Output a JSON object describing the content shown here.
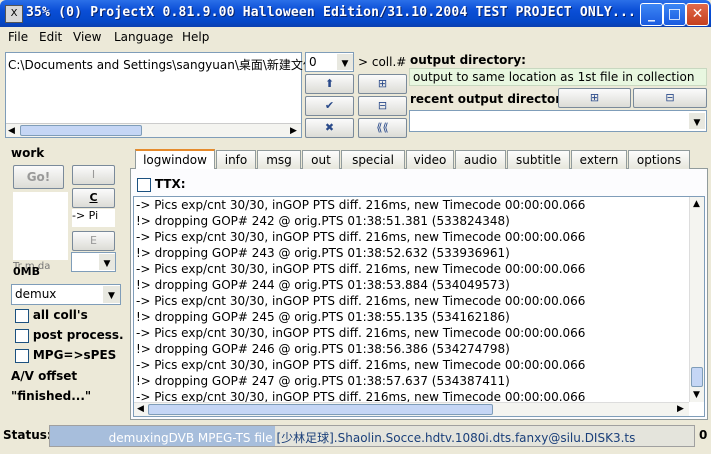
{
  "window": {
    "title": "35% (0) ProjectX 0.81.9.00 Halloween Edition/31.10.2004 TEST PROJECT ONLY...",
    "icon_glyph": "X"
  },
  "menu": [
    "File",
    "Edit",
    "View",
    "Language",
    "Help"
  ],
  "collection": {
    "file_path": "C:\\Documents and Settings\\sangyuan\\桌面\\新建文件",
    "coll_number": "0",
    "coll_label": "> coll.#"
  },
  "output": {
    "directory_label": "output directory:",
    "directory_value": "output to same location as 1st file in collection",
    "recent_label": "recent output directories:",
    "add_glyph": "⊞",
    "remove_glyph": "⊟"
  },
  "left_panel": {
    "work_label": "work",
    "go_label": "Go!",
    "btn_i": "I",
    "btn_c": "C",
    "btn_e": "E",
    "list_text": "-> Pi",
    "size_label": "0MB",
    "overlap_text": "Tr m da",
    "mode": "demux",
    "checkboxes": [
      "all coll's",
      "post process.",
      "MPG=>sPES"
    ],
    "av_offset": "A/V offset",
    "finished": "\"finished...\""
  },
  "tabs": [
    "logwindow",
    "info",
    "msg",
    "out",
    "special",
    "video",
    "audio",
    "subtitle",
    "extern",
    "options"
  ],
  "ttx_label": "TTX:",
  "log_lines": [
    "-> Pics exp/cnt 30/30, inGOP PTS diff. 216ms, new Timecode 00:00:00.066",
    "!> dropping GOP# 242 @ orig.PTS 01:38:51.381 (533824348)",
    "-> Pics exp/cnt 30/30, inGOP PTS diff. 216ms, new Timecode 00:00:00.066",
    "!> dropping GOP# 243 @ orig.PTS 01:38:52.632 (533936961)",
    "-> Pics exp/cnt 30/30, inGOP PTS diff. 216ms, new Timecode 00:00:00.066",
    "!> dropping GOP# 244 @ orig.PTS 01:38:53.884 (534049573)",
    "-> Pics exp/cnt 30/30, inGOP PTS diff. 216ms, new Timecode 00:00:00.066",
    "!> dropping GOP# 245 @ orig.PTS 01:38:55.135 (534162186)",
    "-> Pics exp/cnt 30/30, inGOP PTS diff. 216ms, new Timecode 00:00:00.066",
    "!> dropping GOP# 246 @ orig.PTS 01:38:56.386 (534274798)",
    "-> Pics exp/cnt 30/30, inGOP PTS diff. 216ms, new Timecode 00:00:00.066",
    "!> dropping GOP# 247 @ orig.PTS 01:38:57.637 (534387411)",
    "-> Pics exp/cnt 30/30, inGOP PTS diff. 216ms, new Timecode 00:00:00.066"
  ],
  "status": {
    "label": "Status:",
    "text": "demuxingDVB MPEG-TS file",
    "file": "[少林足球].Shaolin.Socce.hdtv.1080i.dts.fanxy@silu.DISK3.ts",
    "count": "0",
    "progress": 0.35
  },
  "colors": {
    "title_bar": "#0a4ed6",
    "output_dir_bg": "#e8f7e0",
    "status_bar": "#a7bedc",
    "tab_accent": "#e68b2c"
  }
}
